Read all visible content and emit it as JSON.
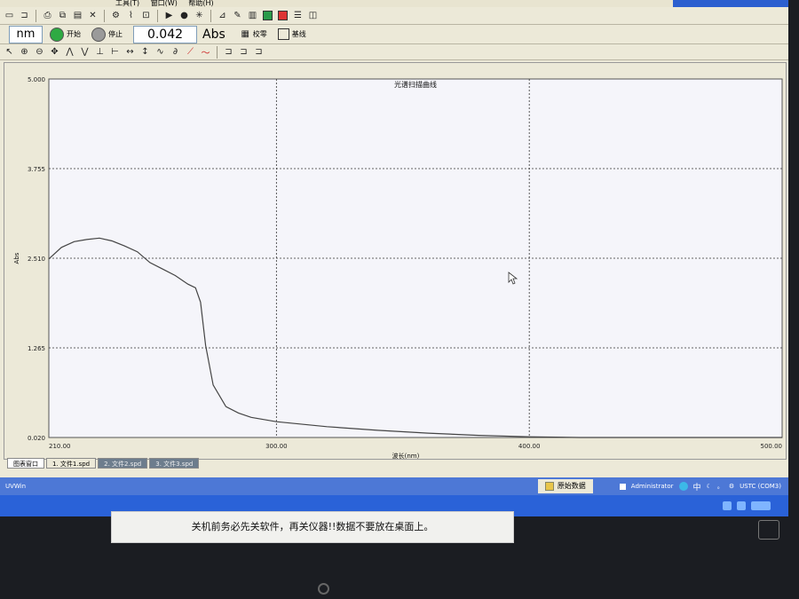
{
  "toolbar": {
    "unit": "nm",
    "start_label": "开始",
    "stop_label": "停止",
    "reading_value": "0.042",
    "reading_unit": "Abs",
    "check_label": "校零",
    "baseline_label": "基线"
  },
  "graph": {
    "title": "光谱扫描曲线",
    "ylabel": "Abs",
    "xlabel": "波长(nm)"
  },
  "chart_data": {
    "type": "line",
    "title": "光谱扫描曲线",
    "xlabel": "波长(nm)",
    "ylabel": "Abs",
    "xlim": [
      210,
      500
    ],
    "ylim": [
      0.02,
      5.0
    ],
    "x_ticks": [
      "210.00",
      "300.00",
      "400.00",
      "500.00"
    ],
    "y_ticks": [
      "0.020",
      "1.265",
      "2.510",
      "3.755",
      "5.000"
    ],
    "grid": true,
    "series": [
      {
        "x": [
          210,
          215,
          220,
          225,
          230,
          235,
          240,
          245,
          250,
          255,
          260,
          265,
          268,
          270,
          272,
          275,
          280,
          285,
          290,
          300,
          320,
          340,
          360,
          380,
          400,
          420,
          440,
          460,
          480,
          500
        ],
        "y": [
          2.5,
          2.66,
          2.74,
          2.77,
          2.79,
          2.75,
          2.68,
          2.6,
          2.45,
          2.36,
          2.27,
          2.15,
          2.1,
          1.9,
          1.3,
          0.75,
          0.45,
          0.36,
          0.3,
          0.24,
          0.17,
          0.12,
          0.08,
          0.05,
          0.03,
          0.02,
          0.02,
          0.02,
          0.02,
          0.02
        ]
      }
    ]
  },
  "tabs": [
    {
      "label": "图表窗口"
    },
    {
      "label": "1. 文件1.spd"
    },
    {
      "label": "2. 文件2.spd"
    },
    {
      "label": "3. 文件3.spd"
    }
  ],
  "appbar": {
    "app_name": "UVWin",
    "raw_data_label": "原始数据",
    "user": "Administrator",
    "ime": "中",
    "port": "USTC (COM3)"
  },
  "notice": {
    "text": "关机前务必先关软件，再关仪器!!数据不要放在桌面上。"
  },
  "menu": {
    "items": [
      "工具(T)",
      "窗口(W)",
      "帮助(H)"
    ]
  }
}
